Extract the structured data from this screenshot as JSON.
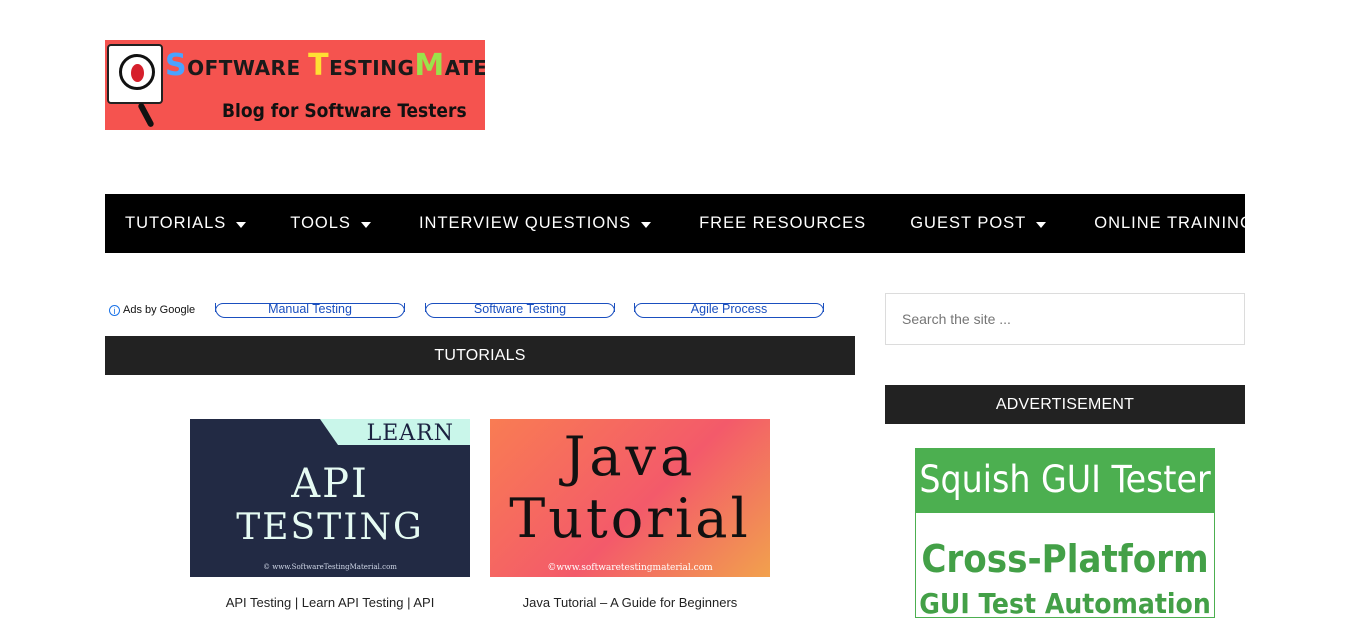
{
  "logo": {
    "title_parts": [
      "S",
      "OFTWARE ",
      "T",
      "ESTING",
      "M",
      "ATERIAL"
    ],
    "tagline": "Blog for Software Testers"
  },
  "nav": {
    "items": [
      {
        "label": "TUTORIALS",
        "has_dropdown": true
      },
      {
        "label": "TOOLS",
        "has_dropdown": true
      },
      {
        "label": "INTERVIEW QUESTIONS",
        "has_dropdown": true
      },
      {
        "label": "FREE RESOURCES",
        "has_dropdown": false
      },
      {
        "label": "GUEST POST",
        "has_dropdown": true
      },
      {
        "label": "ONLINE TRAINING",
        "has_dropdown": false
      }
    ]
  },
  "ads": {
    "info_label": "Ads by Google",
    "links": [
      "Manual Testing",
      "Software Testing",
      "Agile Process"
    ]
  },
  "tutorials": {
    "heading": "TUTORIALS",
    "cards": [
      {
        "thumb_learn": "LEARN",
        "thumb_line1": "API",
        "thumb_line2": "TESTING",
        "thumb_url": "© www.SoftwareTestingMaterial.com",
        "caption": "API Testing | Learn API Testing | API"
      },
      {
        "thumb_line1": "Java",
        "thumb_line2": "Tutorial",
        "thumb_url": "©www.softwaretestingmaterial.com",
        "caption": "Java Tutorial – A Guide for Beginners"
      }
    ]
  },
  "sidebar": {
    "search_placeholder": "Search the site ...",
    "ad_heading": "ADVERTISEMENT",
    "ad": {
      "title": "Squish GUI Tester",
      "line1": "Cross-Platform",
      "line2": "GUI Test Automation"
    }
  },
  "colors": {
    "nav_bg": "#000000",
    "section_bar_bg": "#222222",
    "logo_bg": "#f5534f",
    "ad_green": "#4caf50",
    "link_blue": "#1a4fbf"
  }
}
